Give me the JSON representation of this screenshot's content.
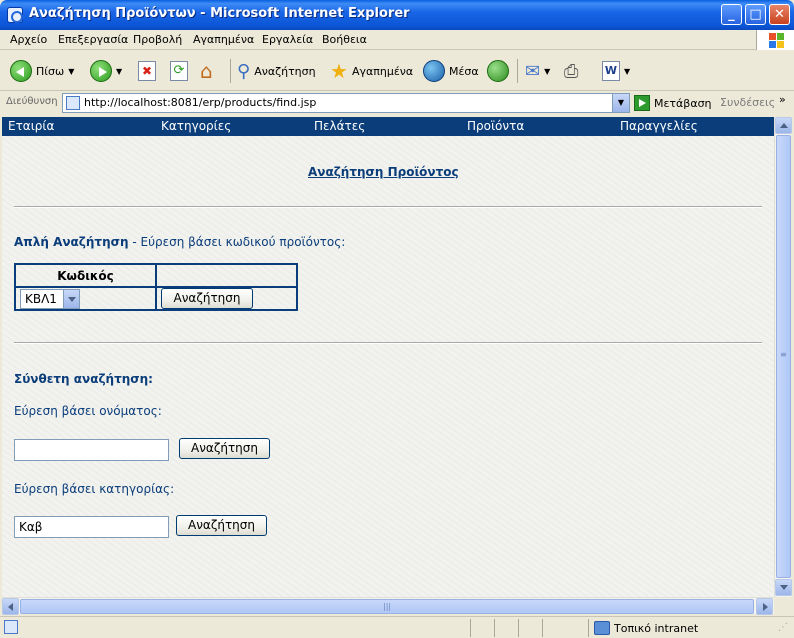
{
  "window": {
    "title": "Αναζήτηση Προϊόντων - Microsoft Internet Explorer",
    "minimize": "_",
    "maximize": "□",
    "close": "✕"
  },
  "menu": [
    "Αρχείο",
    "Επεξεργασία",
    "Προβολή",
    "Αγαπημένα",
    "Εργαλεία",
    "Βοήθεια"
  ],
  "toolbar": {
    "back": "Πίσω",
    "search": "Αναζήτηση",
    "favorites": "Αγαπημένα",
    "media": "Μέσα"
  },
  "address": {
    "label": "Διεύθυνση",
    "url": "http://localhost:8081/erp/products/find.jsp",
    "go": "Μετάβαση",
    "links": "Συνδέσεις",
    "links_more": "»"
  },
  "nav": [
    "Εταιρία",
    "Κατηγορίες",
    "Πελάτες",
    "Προϊόντα",
    "Παραγγελίες"
  ],
  "page": {
    "title": "Αναζήτηση Προϊόντος",
    "simple_heading": "Απλή Αναζήτηση",
    "simple_desc": " - Εύρεση βάσει κωδικού προϊόντος:",
    "code_header": "Κωδικός",
    "code_value": "ΚΒΛ1",
    "search_btn": "Αναζήτηση",
    "complex_heading": "Σύνθετη αναζήτηση:",
    "by_name": "Εύρεση βάσει ονόματος:",
    "name_value": "",
    "by_category": "Εύρεση βάσει κατηγορίας:",
    "category_value": "Καβ"
  },
  "status": {
    "zone": "Τοπικό intranet"
  },
  "colors": {
    "nav_bg": "#0a3d7a",
    "text": "#0a3d7a",
    "titlebar": "#0b56d6"
  }
}
